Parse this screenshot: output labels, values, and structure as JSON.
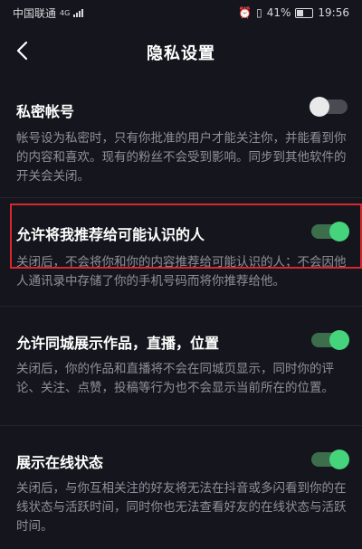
{
  "status_bar": {
    "carrier": "中国联通",
    "network": "4G",
    "battery": "41%",
    "time": "19:56"
  },
  "header": {
    "title": "隐私设置"
  },
  "settings": [
    {
      "title": "私密帐号",
      "description": "帐号设为私密时，只有你批准的用户才能关注你，并能看到你的内容和喜欢。现有的粉丝不会受到影响。同步到其他软件的开关会关闭。",
      "enabled": false
    },
    {
      "title": "允许将我推荐给可能认识的人",
      "description": "关闭后，不会将你和你的内容推荐给可能认识的人；不会因他人通讯录中存储了你的手机号码而将你推荐给他。",
      "enabled": true
    },
    {
      "title": "允许同城展示作品，直播，位置",
      "description": "关闭后，你的作品和直播将不会在同城页显示，同时你的评论、关注、点赞，投稿等行为也不会显示当前所在的位置。",
      "enabled": true
    },
    {
      "title": "展示在线状态",
      "description": "关闭后，与你互相关注的好友将无法在抖音或多闪看到你的在线状态与活跃时间，同时你也无法查看好友的在线状态与活跃时间。",
      "enabled": true
    }
  ],
  "colors": {
    "toggle_on": "#45d47c",
    "highlight_border": "#d8262c"
  }
}
